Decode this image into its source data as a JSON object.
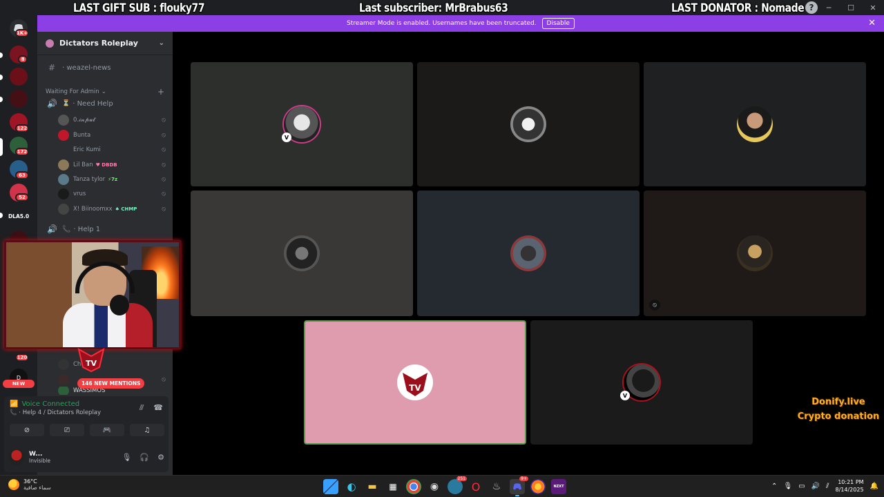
{
  "overlay": {
    "last_gift": "LAST GIFT SUB : flouky77",
    "last_subscriber": "Last subscriber: MrBrabus63",
    "last_donator": "LAST DONATOR : Nomade"
  },
  "banner": {
    "text": "Streamer Mode is enabled. Usernames have been truncated.",
    "button": "Disable",
    "close": "✕"
  },
  "rail": {
    "items": [
      {
        "label": "1K+",
        "color": "#3a1216"
      },
      {
        "label": "8",
        "color": "#7b1420"
      },
      {
        "label": "",
        "color": "#6b1018"
      },
      {
        "label": "",
        "color": "#451015"
      },
      {
        "label": "122",
        "color": "#a01525"
      },
      {
        "label": "172",
        "color": "#2c5f3a"
      },
      {
        "label": "63",
        "color": "#275f8a"
      },
      {
        "label": "52",
        "color": "#d0334a"
      },
      {
        "label": "DLA5.0",
        "color": "#1e1f22"
      },
      {
        "label": "",
        "color": "#3b0f14"
      }
    ],
    "badge_120": "120",
    "new_label": "NEW"
  },
  "sidebar": {
    "server_name": "Dictators Roleplay",
    "channels": {
      "weazel": "· weazel-news",
      "category": "Waiting For Admin",
      "need_help": "· Need Help",
      "help1": "· Help 1"
    },
    "members": [
      {
        "name": "0.𝓲𝓷𝓹𝓾𝓽",
        "tag": "",
        "tag_color": ""
      },
      {
        "name": "Bunta",
        "tag": "",
        "tag_color": ""
      },
      {
        "name": "Eric Kumi",
        "tag": "",
        "tag_color": ""
      },
      {
        "name": "Lil Ban",
        "tag": "♥ DBDB",
        "tag_color": "#ffffff"
      },
      {
        "name": "Tanza tylor",
        "tag": "⚡7z",
        "tag_color": "#ffffff"
      },
      {
        "name": "vrus",
        "tag": "",
        "tag_color": ""
      },
      {
        "name": "X! Biinoomxx",
        "tag": "♠ CHMP",
        "tag_color": "#ffffff"
      }
    ],
    "hidden_member_1": "Che",
    "hidden_member_2": "WASSIMOS",
    "mentions": "146 NEW MENTIONS"
  },
  "voice": {
    "status": "Voice Connected",
    "channel": "· Help 4 / Dictators Roleplay",
    "user_name": "W...",
    "user_status": "Invisible"
  },
  "donify": {
    "line1": "Donify.live",
    "line2": "Crypto donation"
  },
  "taskbar": {
    "temp": "36°C",
    "weather": "سماء صافية",
    "time": "10:21 PM",
    "date": "8/14/2025",
    "discord_badge": "9+",
    "app3_badge": "251"
  },
  "colors": {
    "accent": "#8d3fe6",
    "voice_green": "#23a55a",
    "mention_red": "#f23f43",
    "speaking_tile": "#e09caf"
  }
}
